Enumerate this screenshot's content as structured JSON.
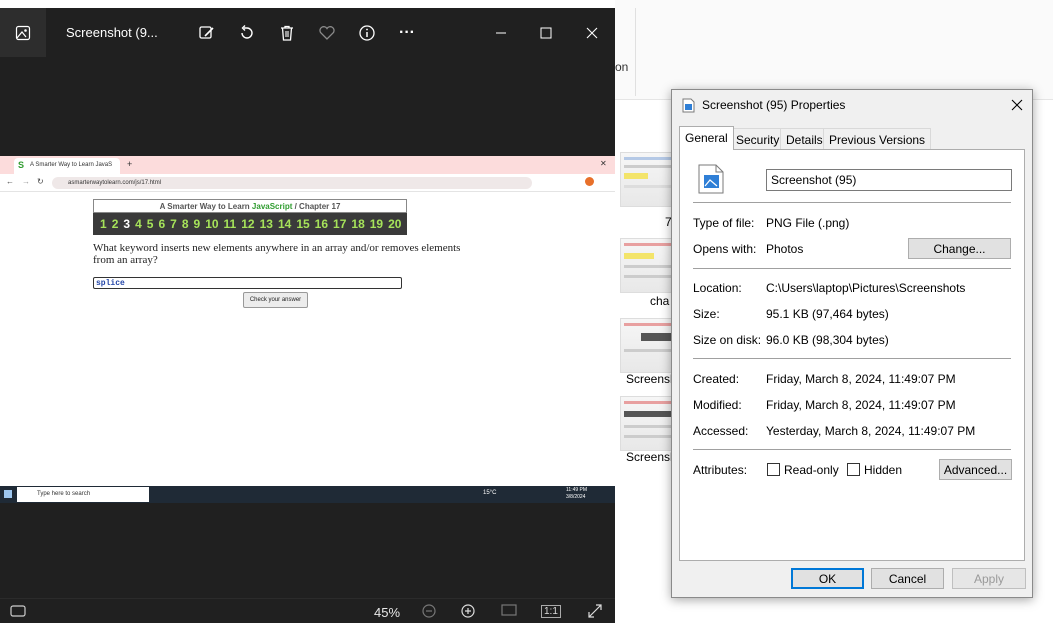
{
  "explorer": {
    "ribbon_fragment": "on",
    "thumbnails": [
      {
        "label": "7"
      },
      {
        "label": "cha"
      },
      {
        "label": "Screensh"
      },
      {
        "label": "Screensh"
      }
    ]
  },
  "photos": {
    "title": "Screenshot (9...",
    "toolbar": [
      "edit-icon",
      "rotate-icon",
      "delete-icon",
      "favorite-icon",
      "info-icon",
      "more-icon"
    ],
    "more_label": "···",
    "zoom": "45%",
    "fit_label": "1:1",
    "inner": {
      "tab_title": "A Smarter Way to Learn JavaS",
      "url": "asmarterwaytolearn.com/js/17.html",
      "header_prefix": "A Smarter Way to Learn ",
      "header_js": "JavaScript",
      "header_suffix": "  /  Chapter 17",
      "chapters": [
        "1",
        "2",
        "3",
        "4",
        "5",
        "6",
        "7",
        "8",
        "9",
        "10",
        "11",
        "12",
        "13",
        "14",
        "15",
        "16",
        "17",
        "18",
        "19",
        "20"
      ],
      "current_chapter": "3",
      "question": "What keyword inserts new elements anywhere in an array and/or removes elements from an array?",
      "answer": "splice",
      "check_button": "Check your answer",
      "taskbar_search": "Type here to search",
      "weather": "15°C",
      "time": "11:49 PM",
      "date": "3/8/2024"
    }
  },
  "properties": {
    "title": "Screenshot (95) Properties",
    "tabs": [
      "General",
      "Security",
      "Details",
      "Previous Versions"
    ],
    "file_name": "Screenshot (95)",
    "type_label": "Type of file:",
    "type_value": "PNG File (.png)",
    "opens_label": "Opens with:",
    "opens_value": "Photos",
    "change_button": "Change...",
    "location_label": "Location:",
    "location_value": "C:\\Users\\laptop\\Pictures\\Screenshots",
    "size_label": "Size:",
    "size_value": "95.1 KB (97,464 bytes)",
    "disk_label": "Size on disk:",
    "disk_value": "96.0 KB (98,304 bytes)",
    "created_label": "Created:",
    "created_value": "Friday, March 8, 2024, 11:49:07 PM",
    "modified_label": "Modified:",
    "modified_value": "Friday, March 8, 2024, 11:49:07 PM",
    "accessed_label": "Accessed:",
    "accessed_value": "Yesterday, March 8, 2024, 11:49:07 PM",
    "attributes_label": "Attributes:",
    "readonly_label": "Read-only",
    "hidden_label": "Hidden",
    "advanced_button": "Advanced...",
    "ok_button": "OK",
    "cancel_button": "Cancel",
    "apply_button": "Apply"
  }
}
